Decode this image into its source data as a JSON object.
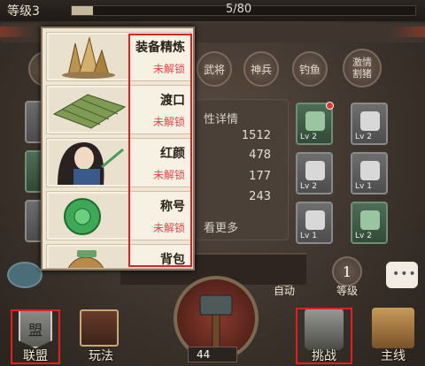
{
  "header": {
    "level_label": "等级3",
    "exp_text": "5/80",
    "exp_fraction": 0.0625
  },
  "nav_row": [
    {
      "id": "wujiang",
      "label": "武将"
    },
    {
      "id": "shenbing",
      "label": "神兵"
    },
    {
      "id": "diaoyu",
      "label": "钓鱼"
    },
    {
      "id": "jiqing",
      "label": "激情\n割猪"
    }
  ],
  "stats": {
    "title": "性详情",
    "values": [
      "1512",
      "478",
      "177",
      "243"
    ],
    "more_label": "看更多"
  },
  "equipment": {
    "right_slots": [
      {
        "lv": "Lv 2",
        "color": "green",
        "dot": true
      },
      {
        "lv": "Lv 2",
        "color": "gray",
        "dot": false
      },
      {
        "lv": "Lv 2",
        "color": "gray",
        "dot": false
      },
      {
        "lv": "Lv 1",
        "color": "gray",
        "dot": false
      },
      {
        "lv": "Lv 1",
        "color": "gray",
        "dot": false
      },
      {
        "lv": "Lv 2",
        "color": "green",
        "dot": false
      }
    ]
  },
  "controls": {
    "auto_label": "自动",
    "level_value": "1",
    "level_label": "等级"
  },
  "popup": {
    "items": [
      {
        "title": "装备精炼",
        "status": "未解锁",
        "icon": "crystal-icon"
      },
      {
        "title": "渡口",
        "status": "未解锁",
        "icon": "raft-icon"
      },
      {
        "title": "红颜",
        "status": "未解锁",
        "icon": "beauty-portrait-icon"
      },
      {
        "title": "称号",
        "status": "未解锁",
        "icon": "jade-seal-icon"
      },
      {
        "title": "背包",
        "status": "",
        "icon": "bag-icon"
      }
    ]
  },
  "bottom_nav": {
    "lianmeng": "联盟",
    "wanfa": "玩法",
    "tiaozhan": "挑战",
    "zhuxian": "主线",
    "center_count": "44",
    "alliance_glyph": "盟"
  },
  "colors": {
    "highlight": "#e02020",
    "locked_text": "#d64a4a"
  }
}
